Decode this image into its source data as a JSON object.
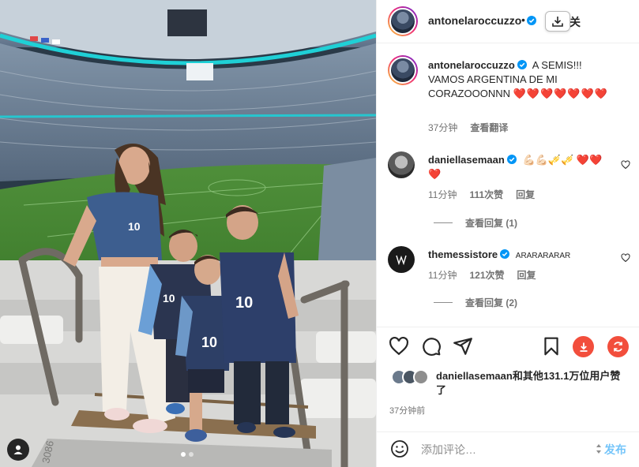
{
  "post": {
    "author": "antonelaroccuzzo",
    "header_bullet": "•",
    "header_follow_partial": "关",
    "caption": {
      "text": "A SEMIS!!! VAMOS ARGENTINA DE MI CORAZOOONNN",
      "hearts_emoji": "❤️❤️❤️❤️❤️❤️❤️",
      "time": "37分钟",
      "translate": "查看翻译"
    },
    "comments": [
      {
        "username": "daniellasemaan",
        "text": "💪🏻💪🏻🎺🎺 ❤️❤️❤️",
        "time": "11分钟",
        "likes": "111次赞",
        "reply": "回复",
        "view_replies": "查看回复 (1)"
      },
      {
        "username": "themessistore",
        "text": "ARARARARAR",
        "time": "11分钟",
        "likes": "121次赞",
        "reply": "回复",
        "view_replies": "查看回复 (2)"
      }
    ],
    "likes_text_user": "daniellasemaan",
    "likes_text_rest": "和其他131.1万位用户赞了",
    "time_ago": "37分钟前",
    "add_comment_placeholder": "添加评论…",
    "post_button": "发布",
    "jersey_number": "10",
    "stadium_sign": "3086"
  },
  "colors": {
    "accent_blue": "#0095f6",
    "verified_blue": "#0095f6",
    "heart_red": "#ed1c24",
    "download_red": "#f24e3c",
    "text_primary": "#262626",
    "text_secondary": "#737373"
  },
  "icons": [
    "verified-badge-icon",
    "download-icon",
    "heart-icon",
    "comment-icon",
    "share-icon",
    "bookmark-icon",
    "download-circle-icon",
    "repost-circle-icon",
    "emoji-icon",
    "user-tag-icon"
  ]
}
